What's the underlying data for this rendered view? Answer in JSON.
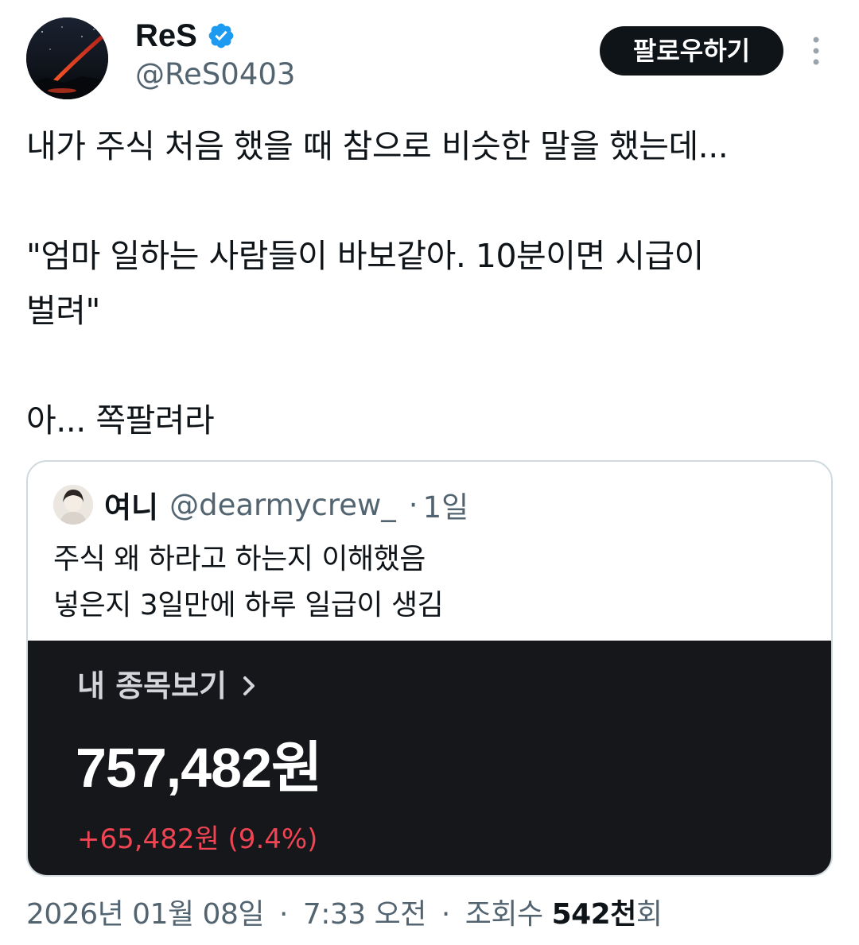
{
  "author": {
    "display_name": "ReS",
    "handle": "@ReS0403",
    "verified_icon": "verified-badge-icon",
    "avatar_icon": "meteor-night-sky-avatar"
  },
  "actions": {
    "follow_label": "팔로우하기",
    "more_icon": "more-vertical-icon"
  },
  "tweet": {
    "lines": [
      "내가 주식 처음 했을 때 참으로 비슷한 말을 했는데...",
      "\"엄마 일하는 사람들이 바보같아. 10분이면 시급이",
      "벌려\"",
      "아... 쪽팔려라"
    ]
  },
  "quote": {
    "display_name": "여니",
    "handle": "@dearmycrew_",
    "separator": "·",
    "time": "1일",
    "lines": [
      "주식 왜 하라고 하는지 이해했음",
      "넣은지 3일만에 하루 일급이 생김"
    ],
    "image": {
      "link_label": "내 종목보기",
      "balance": "757,482원",
      "change": "+65,482원 (9.4%)",
      "colors": {
        "background": "#16171b",
        "change": "#f04452"
      }
    }
  },
  "meta": {
    "date": "2026년 01월 08일",
    "sep1": "·",
    "time": "7:33 오전",
    "sep2": "·",
    "views_label": "조회수",
    "views_count": "542천",
    "views_suffix": "회"
  },
  "colors": {
    "text": "#0f1419",
    "secondary": "#536471",
    "verified": "#1d9bf0",
    "border": "#cfd9de"
  }
}
